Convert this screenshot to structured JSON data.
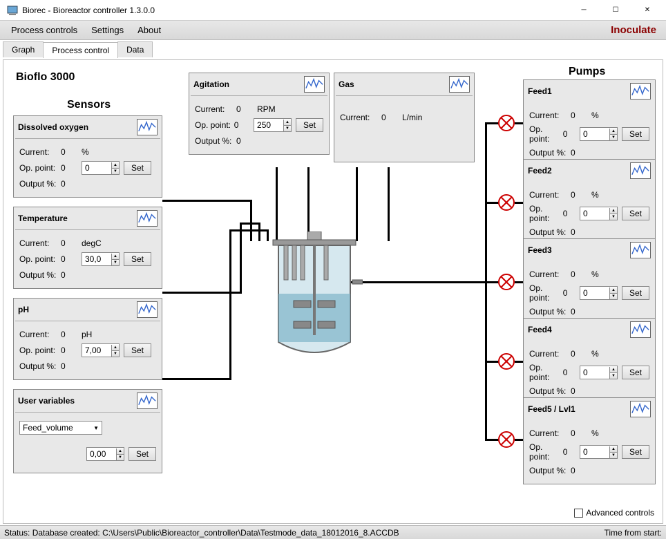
{
  "window": {
    "title": "Biorec - Bioreactor controller 1.3.0.0"
  },
  "menu": {
    "items": [
      "Process controls",
      "Settings",
      "About"
    ],
    "inoculate": "Inoculate"
  },
  "tabs": {
    "items": [
      "Graph",
      "Process control",
      "Data"
    ],
    "active": 1
  },
  "headings": {
    "device": "Bioflo 3000",
    "sensors": "Sensors",
    "pumps": "Pumps"
  },
  "labels": {
    "current": "Current:",
    "oppoint": "Op. point:",
    "output": "Output %:",
    "set": "Set"
  },
  "sensors": {
    "do": {
      "title": "Dissolved oxygen",
      "current": "0",
      "unit": "%",
      "op_readout": "0",
      "op_input": "0",
      "output": "0"
    },
    "temp": {
      "title": "Temperature",
      "current": "0",
      "unit": "degC",
      "op_readout": "0",
      "op_input": "30,0",
      "output": "0"
    },
    "ph": {
      "title": "pH",
      "current": "0",
      "unit": "pH",
      "op_readout": "0",
      "op_input": "7,00",
      "output": "0"
    },
    "user": {
      "title": "User variables",
      "select": "Feed_volume",
      "op_input": "0,00"
    }
  },
  "agitation": {
    "title": "Agitation",
    "current": "0",
    "unit": "RPM",
    "op_readout": "0",
    "op_input": "250",
    "output": "0"
  },
  "gas": {
    "title": "Gas",
    "current": "0",
    "unit": "L/min"
  },
  "pumps": {
    "feed1": {
      "title": "Feed1",
      "current": "0",
      "unit": "%",
      "op_readout": "0",
      "op_input": "0",
      "output": "0"
    },
    "feed2": {
      "title": "Feed2",
      "current": "0",
      "unit": "%",
      "op_readout": "0",
      "op_input": "0",
      "output": "0"
    },
    "feed3": {
      "title": "Feed3",
      "current": "0",
      "unit": "%",
      "op_readout": "0",
      "op_input": "0",
      "output": "0"
    },
    "feed4": {
      "title": "Feed4",
      "current": "0",
      "unit": "%",
      "op_readout": "0",
      "op_input": "0",
      "output": "0"
    },
    "feed5": {
      "title": "Feed5 / Lvl1",
      "current": "0",
      "unit": "%",
      "op_readout": "0",
      "op_input": "0",
      "output": "0"
    }
  },
  "advanced": "Advanced controls",
  "status": {
    "left": "Status: Database created: C:\\Users\\Public\\Bioreactor_controller\\Data\\Testmode_data_18012016_8.ACCDB",
    "right": "Time from start:"
  }
}
